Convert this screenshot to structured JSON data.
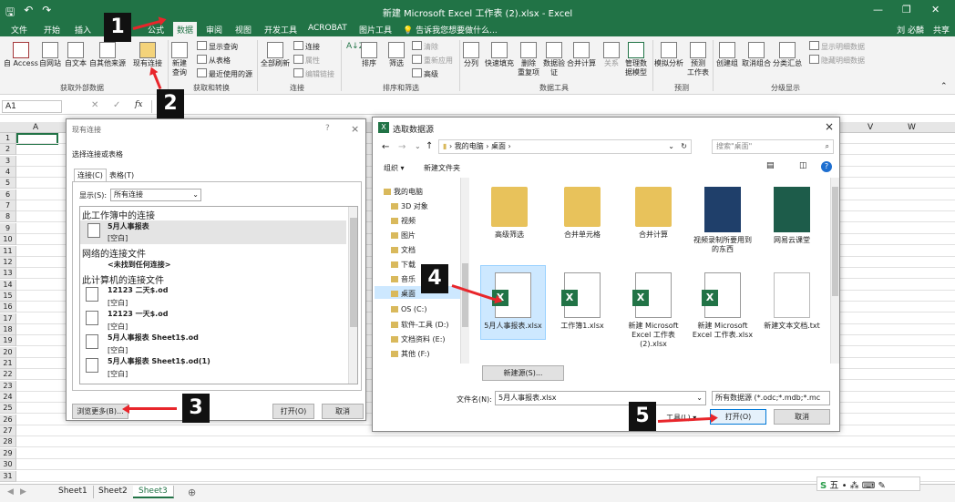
{
  "app": {
    "window_title": "新建 Microsoft Excel 工作表 (2).xlsx - Excel",
    "user": "刘 必麟",
    "share": "共享"
  },
  "tabs": [
    "文件",
    "开始",
    "插入",
    "公式",
    "数据",
    "审阅",
    "视图",
    "开发工具",
    "ACROBAT",
    "图片工具"
  ],
  "tell_me": "告诉我您想要做什么...",
  "ribbon": {
    "get_external": {
      "access": "自 Access",
      "web": "自网站",
      "text": "自文本",
      "other": "自其他来源",
      "existing": "现有连接",
      "group": "获取外部数据"
    },
    "transform": {
      "new_query": "新建\n查询",
      "show_query": "显示查询",
      "from_table": "从表格",
      "recent": "最近使用的源",
      "group": "获取和转换"
    },
    "connections": {
      "refresh": "全部刷新",
      "conn": "连接",
      "props": "属性",
      "edit": "编辑链接",
      "group": "连接"
    },
    "sort": {
      "sort": "排序",
      "filter": "筛选",
      "clear": "清除",
      "reapply": "重新应用",
      "advanced": "高级",
      "group": "排序和筛选"
    },
    "tools": {
      "split": "分列",
      "flash": "快速填充",
      "dup": "删除\n重复项",
      "validate": "数据验\n证",
      "consolidate": "合并计算",
      "rel": "关系",
      "model": "管理数\n据模型",
      "group": "数据工具"
    },
    "forecast": {
      "whatif": "模拟分析",
      "sheet": "预测\n工作表",
      "group": "预测"
    },
    "outline": {
      "group_btn": "创建组",
      "ungroup": "取消组合",
      "subtotal": "分类汇总",
      "show": "显示明细数据",
      "hide": "隐藏明细数据",
      "group": "分级显示"
    }
  },
  "formula_bar": {
    "cell": "A1",
    "fx": "fx"
  },
  "columns": {
    "a": "A",
    "v": "V",
    "w": "W"
  },
  "rows": [
    "1",
    "2",
    "3",
    "4",
    "5",
    "6",
    "7",
    "8",
    "9",
    "10",
    "11",
    "12",
    "13",
    "14",
    "15",
    "16",
    "17",
    "18",
    "19",
    "20",
    "21",
    "22",
    "23",
    "24",
    "25",
    "26",
    "27",
    "28",
    "29",
    "30",
    "31"
  ],
  "sheets": [
    "Sheet1",
    "Sheet2",
    "Sheet3"
  ],
  "existing_dialog": {
    "title": "现有连接",
    "help": "?",
    "close": "×",
    "subtitle": "选择连接或表格",
    "tab_conn": "连接(C)",
    "tab_table": "表格(T)",
    "show_label": "显示(S):",
    "show_value": "所有连接",
    "section1": "此工作簿中的连接",
    "item1_name": "5月人事报表",
    "item1_sub": "[空白]",
    "section2": "网络的连接文件",
    "section2_empty": "<未找到任何连接>",
    "section3": "此计算机的连接文件",
    "files": [
      {
        "name": "12123 二天$.od",
        "sub": "[空白]"
      },
      {
        "name": "12123 一天$.od",
        "sub": "[空白]"
      },
      {
        "name": "5月人事报表 Sheet1$.od",
        "sub": "[空白]"
      },
      {
        "name": "5月人事报表 Sheet1$.od(1)",
        "sub": "[空白]"
      }
    ],
    "browse": "浏览更多(B)...",
    "open": "打开(O)",
    "cancel": "取消"
  },
  "select_dialog": {
    "title": "选取数据源",
    "close": "×",
    "path": [
      "我的电脑",
      "桌面"
    ],
    "search_placeholder": "搜索\"桌面\"",
    "organize": "组织 ▾",
    "new_folder": "新建文件夹",
    "nav": [
      "我的电脑",
      "3D 对象",
      "视频",
      "图片",
      "文档",
      "下载",
      "音乐",
      "桌面",
      "OS (C:)",
      "软件-工具 (D:)",
      "文档资料 (E:)",
      "其他 (F:)"
    ],
    "files": [
      {
        "label": "高级筛选",
        "kind": "folder"
      },
      {
        "label": "合并单元格",
        "kind": "folder"
      },
      {
        "label": "合并计算",
        "kind": "folder"
      },
      {
        "label": "视频录制所要用到的东西",
        "kind": "folder"
      },
      {
        "label": "网易云课堂",
        "kind": "folder"
      },
      {
        "label": "5月人事报表.xlsx",
        "kind": "xlsx"
      },
      {
        "label": "工作簿1.xlsx",
        "kind": "xlsx"
      },
      {
        "label": "新建 Microsoft Excel 工作表 (2).xlsx",
        "kind": "xlsx"
      },
      {
        "label": "新建 Microsoft Excel 工作表.xlsx",
        "kind": "xlsx"
      },
      {
        "label": "新建文本文档.txt",
        "kind": "txt"
      }
    ],
    "new_source": "新建源(S)...",
    "filename_label": "文件名(N):",
    "filename_value": "5月人事报表.xlsx",
    "filetype": "所有数据源 (*.odc;*.mdb;*.mc",
    "tools": "工具(L)",
    "open": "打开(O)",
    "cancel": "取消"
  },
  "badges": [
    "1",
    "2",
    "3",
    "4",
    "5"
  ],
  "status_icons": "五"
}
